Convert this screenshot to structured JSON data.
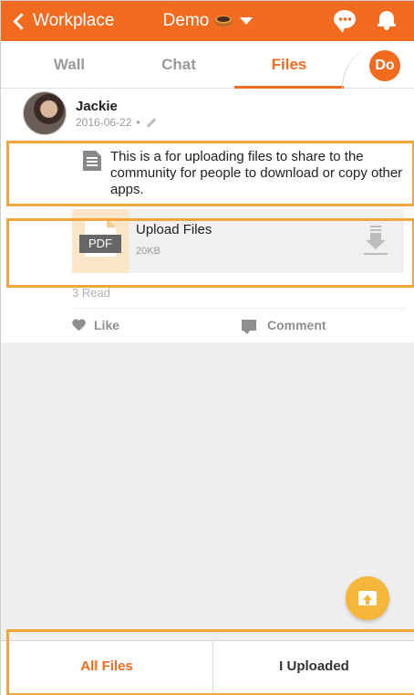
{
  "header": {
    "back_label": "Workplace",
    "title": "Demo",
    "icons": [
      "back-chevron-icon",
      "donut-icon",
      "dropdown-caret-icon",
      "chat-bubble-icon",
      "bell-icon"
    ],
    "colors": {
      "brand": "#f26b1f"
    }
  },
  "tabs": {
    "items": [
      {
        "label": "Wall"
      },
      {
        "label": "Chat"
      },
      {
        "label": "Files",
        "active": true
      }
    ],
    "badge": "Do"
  },
  "post": {
    "author": "Jackie",
    "date": "2016-06-22",
    "separator": "•",
    "description": "This is a for uploading files to share to the community for people to download or copy other apps.",
    "file": {
      "type_label": "PDF",
      "name": "Upload Files",
      "size": "20KB"
    },
    "read_count": "3 Read",
    "actions": {
      "like": "Like",
      "comment": "Comment"
    }
  },
  "bottom_tabs": {
    "all_files": "All Files",
    "uploaded": "I Uploaded",
    "active_color": "#f26b1f"
  },
  "highlight_color": "#f4a63c",
  "fab_color": "#f6b63a"
}
